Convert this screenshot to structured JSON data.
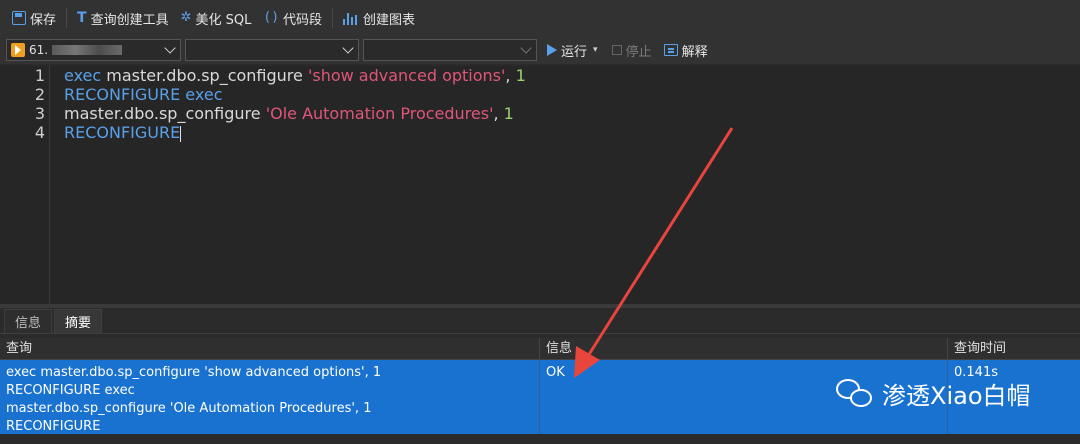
{
  "toolbar": {
    "save": "保存",
    "query_builder": "查询创建工具",
    "beautify_sql": "美化 SQL",
    "code_snippet": "代码段",
    "create_chart": "创建图表"
  },
  "toolbar2": {
    "connection": "61.",
    "run": "运行",
    "stop": "停止",
    "explain": "解释"
  },
  "editor": {
    "line_numbers": [
      "1",
      "2",
      "3",
      "4"
    ],
    "lines": [
      [
        {
          "t": "kw",
          "v": "exec "
        },
        {
          "t": "id",
          "v": "master.dbo.sp_configure "
        },
        {
          "t": "str",
          "v": "'show advanced options'"
        },
        {
          "t": "id",
          "v": ", "
        },
        {
          "t": "num",
          "v": "1"
        }
      ],
      [
        {
          "t": "kw",
          "v": "RECONFIGURE exec"
        }
      ],
      [
        {
          "t": "id",
          "v": "master.dbo.sp_configure "
        },
        {
          "t": "str",
          "v": "'Ole Automation Procedures'"
        },
        {
          "t": "id",
          "v": ", "
        },
        {
          "t": "num",
          "v": "1"
        }
      ],
      [
        {
          "t": "kw",
          "v": "RECONFIGURE"
        }
      ]
    ]
  },
  "tabs": {
    "info": "信息",
    "summary": "摘要"
  },
  "results": {
    "headers": [
      "查询",
      "信息",
      "查询时间"
    ],
    "row": {
      "query_lines": [
        "exec master.dbo.sp_configure 'show advanced options', 1",
        "RECONFIGURE exec",
        "master.dbo.sp_configure 'Ole Automation Procedures', 1",
        "RECONFIGURE"
      ],
      "message": "OK",
      "time": "0.141s"
    }
  },
  "watermark": "渗透Xiao白帽",
  "colors": {
    "accent": "#5aa0e8",
    "selection": "#1a72d0",
    "string": "#e0567a",
    "number": "#9bd26a",
    "arrow": "#e8453c"
  }
}
